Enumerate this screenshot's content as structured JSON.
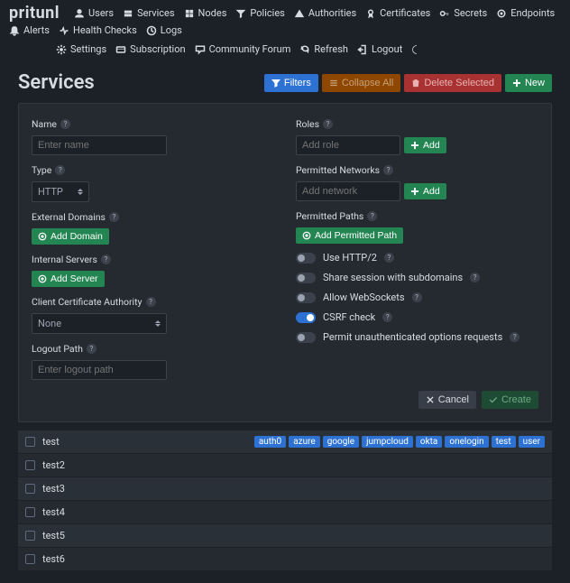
{
  "brand": "pritunl",
  "nav": {
    "row1": [
      {
        "id": "users",
        "label": "Users"
      },
      {
        "id": "services",
        "label": "Services"
      },
      {
        "id": "nodes",
        "label": "Nodes"
      },
      {
        "id": "policies",
        "label": "Policies"
      },
      {
        "id": "authorities",
        "label": "Authorities"
      },
      {
        "id": "certificates",
        "label": "Certificates"
      },
      {
        "id": "secrets",
        "label": "Secrets"
      },
      {
        "id": "endpoints",
        "label": "Endpoints"
      },
      {
        "id": "alerts",
        "label": "Alerts"
      },
      {
        "id": "health",
        "label": "Health Checks"
      },
      {
        "id": "logs",
        "label": "Logs"
      }
    ],
    "row2": [
      {
        "id": "settings",
        "label": "Settings"
      },
      {
        "id": "subscription",
        "label": "Subscription"
      },
      {
        "id": "forum",
        "label": "Community Forum"
      },
      {
        "id": "refresh",
        "label": "Refresh"
      },
      {
        "id": "logout",
        "label": "Logout"
      },
      {
        "id": "theme",
        "label": ""
      }
    ]
  },
  "page_title": "Services",
  "actions": {
    "filters": "Filters",
    "collapse": "Collapse All",
    "delete": "Delete Selected",
    "new": "New"
  },
  "form": {
    "name_label": "Name",
    "name_placeholder": "Enter name",
    "type_label": "Type",
    "type_value": "HTTP",
    "ext_domains_label": "External Domains",
    "add_domain": "Add Domain",
    "int_servers_label": "Internal Servers",
    "add_server": "Add Server",
    "cca_label": "Client Certificate Authority",
    "cca_value": "None",
    "logout_label": "Logout Path",
    "logout_placeholder": "Enter logout path",
    "roles_label": "Roles",
    "role_placeholder": "Add role",
    "add": "Add",
    "perm_net_label": "Permitted Networks",
    "net_placeholder": "Add network",
    "perm_paths_label": "Permitted Paths",
    "add_perm_path": "Add Permitted Path",
    "opts": [
      {
        "id": "http2",
        "label": "Use HTTP/2",
        "on": false
      },
      {
        "id": "share",
        "label": "Share session with subdomains",
        "on": false
      },
      {
        "id": "ws",
        "label": "Allow WebSockets",
        "on": false
      },
      {
        "id": "csrf",
        "label": "CSRF check",
        "on": true
      },
      {
        "id": "unauth",
        "label": "Permit unauthenticated options requests",
        "on": false
      }
    ],
    "cancel": "Cancel",
    "create": "Create"
  },
  "rows": [
    {
      "name": "test",
      "tags": [
        "auth0",
        "azure",
        "google",
        "jumpcloud",
        "okta",
        "onelogin",
        "test",
        "user"
      ]
    },
    {
      "name": "test2",
      "tags": []
    },
    {
      "name": "test3",
      "tags": []
    },
    {
      "name": "test4",
      "tags": []
    },
    {
      "name": "test5",
      "tags": []
    },
    {
      "name": "test6",
      "tags": []
    }
  ]
}
